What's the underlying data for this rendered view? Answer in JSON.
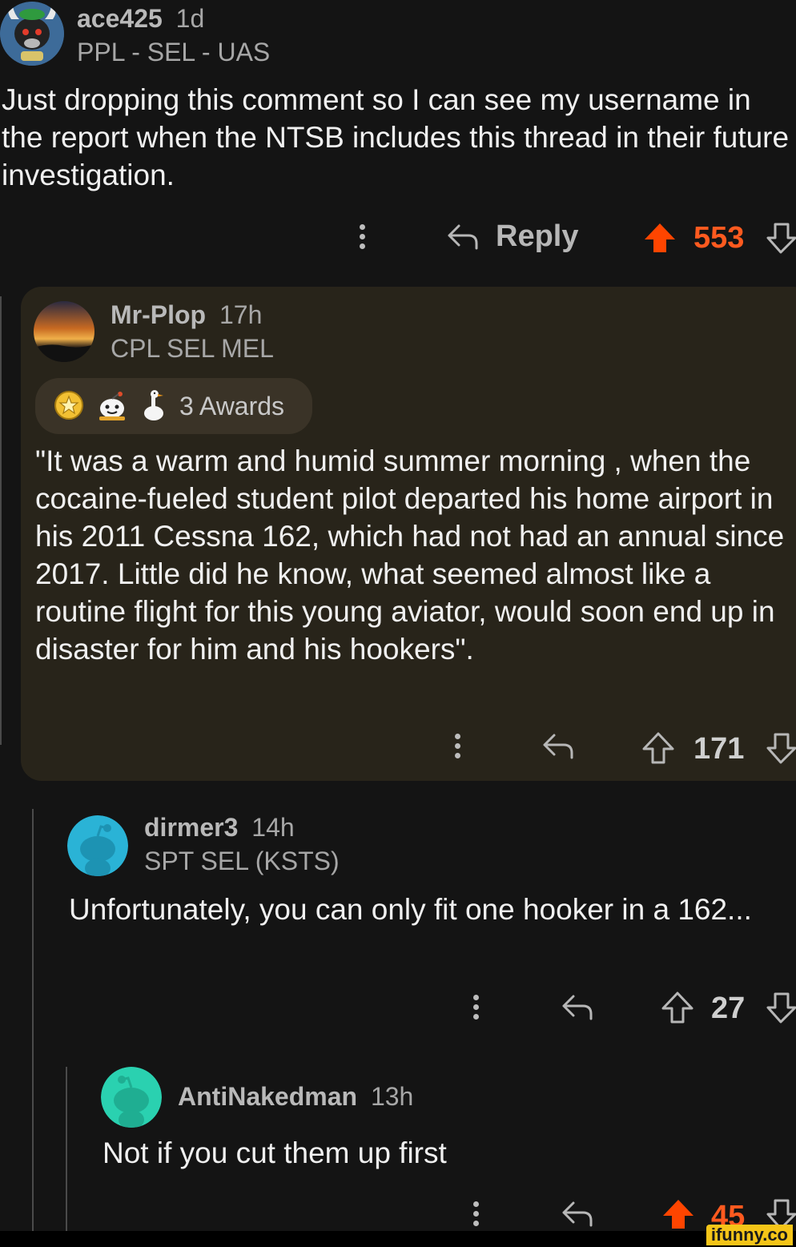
{
  "comments": [
    {
      "username": "ace425",
      "age": "1d",
      "flair": "PPL - SEL - UAS",
      "body": "Just dropping this comment so I can see my username in the report when the NTSB includes this thread in their future investigation.",
      "reply_label": "Reply",
      "score": "553",
      "upvoted": true,
      "avatar_icon": "bull-mascot-avatar-icon"
    },
    {
      "username": "Mr-Plop",
      "age": "17h",
      "flair": "CPL SEL MEL",
      "awards_label": "3 Awards",
      "award_icons": [
        "gold-star-award-icon",
        "wholesome-snoo-award-icon",
        "goose-award-icon"
      ],
      "body": "\"It was a warm and humid summer morning , when the cocaine-fueled student pilot departed his home airport in his 2011 Cessna 162, which had not had an annual since 2017. Little did he know, what seemed almost like a routine flight for this young aviator, would soon end up in disaster for him and his hookers\".",
      "score": "171",
      "upvoted": false,
      "avatar_icon": "sunset-avatar-icon"
    },
    {
      "username": "dirmer3",
      "age": "14h",
      "flair": "SPT SEL (KSTS)",
      "body": "Unfortunately, you can only fit one hooker in a 162...",
      "score": "27",
      "upvoted": false,
      "avatar_icon": "snoo-avatar-icon"
    },
    {
      "username": "AntiNakedman",
      "age": "13h",
      "body": "Not if you cut them up first",
      "score": "45",
      "upvoted": true,
      "avatar_icon": "snoo-avatar-icon"
    }
  ],
  "watermark": "ifunny.co",
  "colors": {
    "background": "#141414",
    "highlight_background": "#28241a",
    "upvote_orange": "#ff4500",
    "username_gray": "#b9b9b9",
    "snoo_teal": "#2ad1b0",
    "snoo_blue": "#2ab3d6"
  }
}
